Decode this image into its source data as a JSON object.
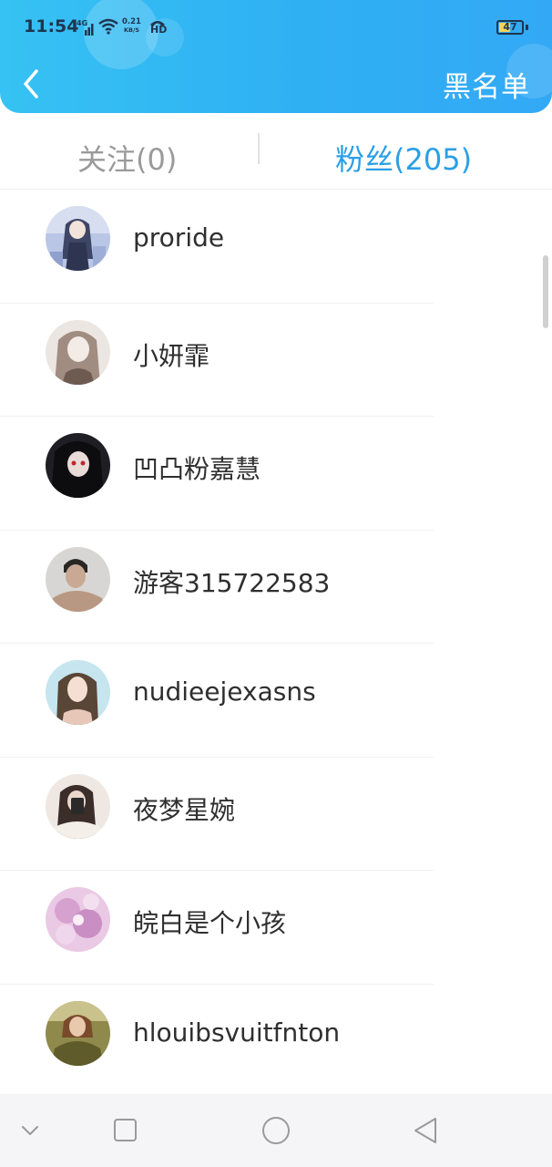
{
  "status_bar": {
    "time": "11:54",
    "network": "4G",
    "speed_value": "0.21",
    "speed_unit": "KB/S",
    "hd": "HD",
    "battery": "47",
    "battery_level": 0.47
  },
  "header": {
    "back_icon": "chevron-left-icon",
    "blacklist_label": "黑名单",
    "color_start": "#36c2f3",
    "color_end": "#33a9f5"
  },
  "tabs": {
    "following_label": "关注(0)",
    "fans_label": "粉丝(205)",
    "active": "fans",
    "active_color": "#2b9fe6"
  },
  "fans": [
    {
      "name": "proride",
      "avatar": "anime-girl-avatar"
    },
    {
      "name": "小妍霏",
      "avatar": "sketch-girl-avatar"
    },
    {
      "name": "凹凸粉嘉慧",
      "avatar": "dark-anime-avatar"
    },
    {
      "name": "游客315722583",
      "avatar": "man-photo-avatar"
    },
    {
      "name": "nudieejexasns",
      "avatar": "woman-photo-avatar"
    },
    {
      "name": "夜梦星婉",
      "avatar": "girl-mirror-avatar"
    },
    {
      "name": "皖白是个小孩",
      "avatar": "pink-flower-avatar"
    },
    {
      "name": "hlouibsvuitfnton",
      "avatar": "woman-field-avatar"
    }
  ],
  "nav_bar": {
    "icons": [
      "chevron-down-icon",
      "square-icon",
      "circle-icon",
      "triangle-back-icon"
    ]
  }
}
